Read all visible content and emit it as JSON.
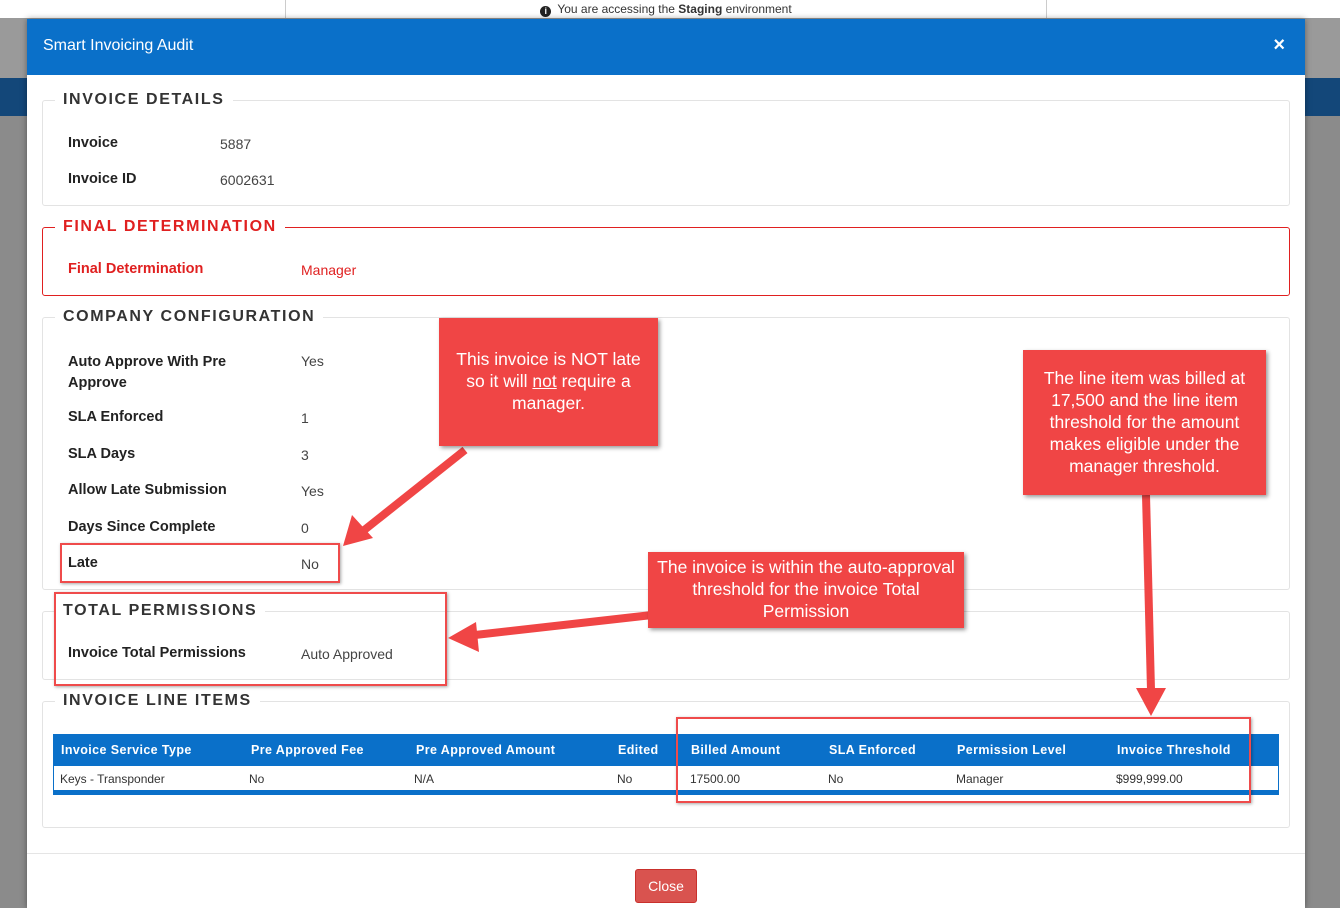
{
  "environment": {
    "prefix": "You are accessing the",
    "name": "Staging",
    "suffix": "environment"
  },
  "modal": {
    "title": "Smart Invoicing Audit",
    "close_icon": "×",
    "close_button": "Close"
  },
  "invoice_details": {
    "heading": "INVOICE DETAILS",
    "invoice_label": "Invoice",
    "invoice_value": "5887",
    "invoice_id_label": "Invoice ID",
    "invoice_id_value": "6002631"
  },
  "final_determination": {
    "heading": "FINAL DETERMINATION",
    "label": "Final Determination",
    "value": "Manager"
  },
  "company_configuration": {
    "heading": "COMPANY CONFIGURATION",
    "rows": [
      {
        "label": "Auto Approve With Pre Approve",
        "value": "Yes"
      },
      {
        "label": "SLA Enforced",
        "value": "1"
      },
      {
        "label": "SLA Days",
        "value": "3"
      },
      {
        "label": "Allow Late Submission",
        "value": "Yes"
      },
      {
        "label": "Days Since Complete",
        "value": "0"
      },
      {
        "label": "Late",
        "value": "No"
      }
    ]
  },
  "total_permissions": {
    "heading": "TOTAL PERMISSIONS",
    "label": "Invoice Total Permissions",
    "value": "Auto Approved"
  },
  "line_items": {
    "heading": "INVOICE LINE ITEMS",
    "columns": [
      "Invoice Service Type",
      "Pre Approved Fee",
      "Pre Approved Amount",
      "Edited",
      "Billed Amount",
      "SLA Enforced",
      "Permission Level",
      "Invoice Threshold"
    ],
    "rows": [
      [
        "Keys - Transponder",
        "No",
        "N/A",
        "No",
        "17500.00",
        "No",
        "Manager",
        "$999,999.00"
      ]
    ]
  },
  "annotations": {
    "late": {
      "pre": "This invoice is NOT late so it will ",
      "emph": "not",
      "post": " require a manager."
    },
    "line_item": "The line item was billed at 17,500 and the line item threshold for the amount makes eligible under the manager threshold.",
    "total": "The invoice is within the auto-approval threshold for the invoice Total Permission",
    "color": "#f04545"
  },
  "colors": {
    "header_blue": "#0a70c9",
    "determination_red": "#e02020",
    "close_button": "#d9534f"
  }
}
